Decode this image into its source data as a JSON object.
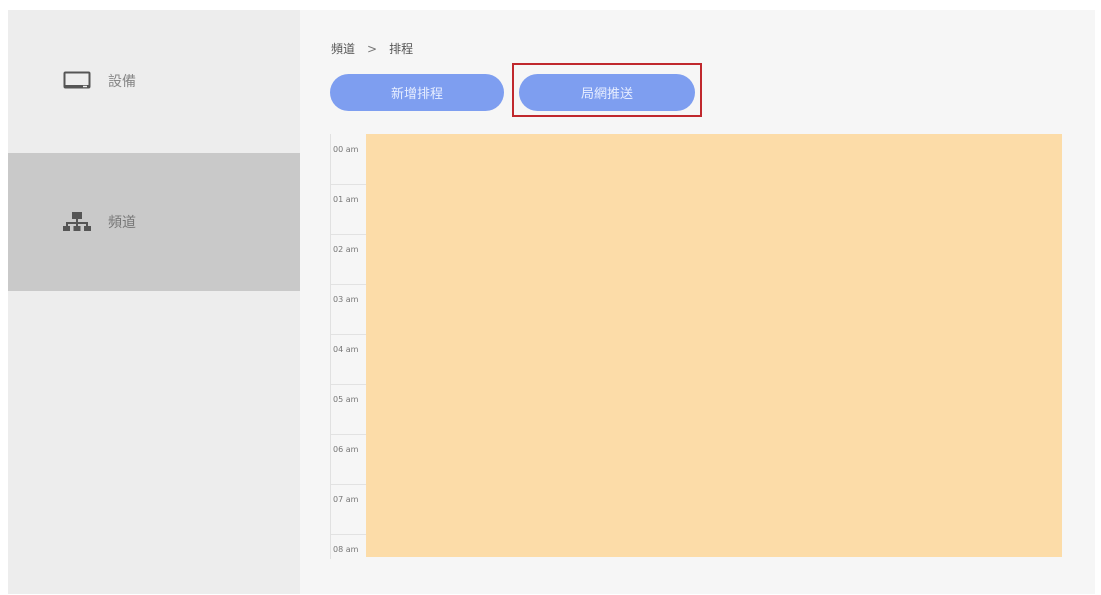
{
  "sidebar": {
    "items": [
      {
        "label": "設備",
        "icon": "monitor-icon",
        "active": false
      },
      {
        "label": "頻道",
        "icon": "network-icon",
        "active": true
      }
    ]
  },
  "breadcrumb": {
    "parent": "頻道",
    "separator": ">",
    "current": "排程"
  },
  "toolbar": {
    "add_schedule_label": "新增排程",
    "lan_push_label": "局網推送"
  },
  "schedule": {
    "time_slots": [
      "00 am",
      "01 am",
      "02 am",
      "03 am",
      "04 am",
      "05 am",
      "06 am",
      "07 am",
      "08 am"
    ]
  },
  "colors": {
    "button": "#7e9ef0",
    "slot_fill": "#fcdca8",
    "highlight": "#c0282d",
    "sidebar_active": "#c9c9c9"
  }
}
